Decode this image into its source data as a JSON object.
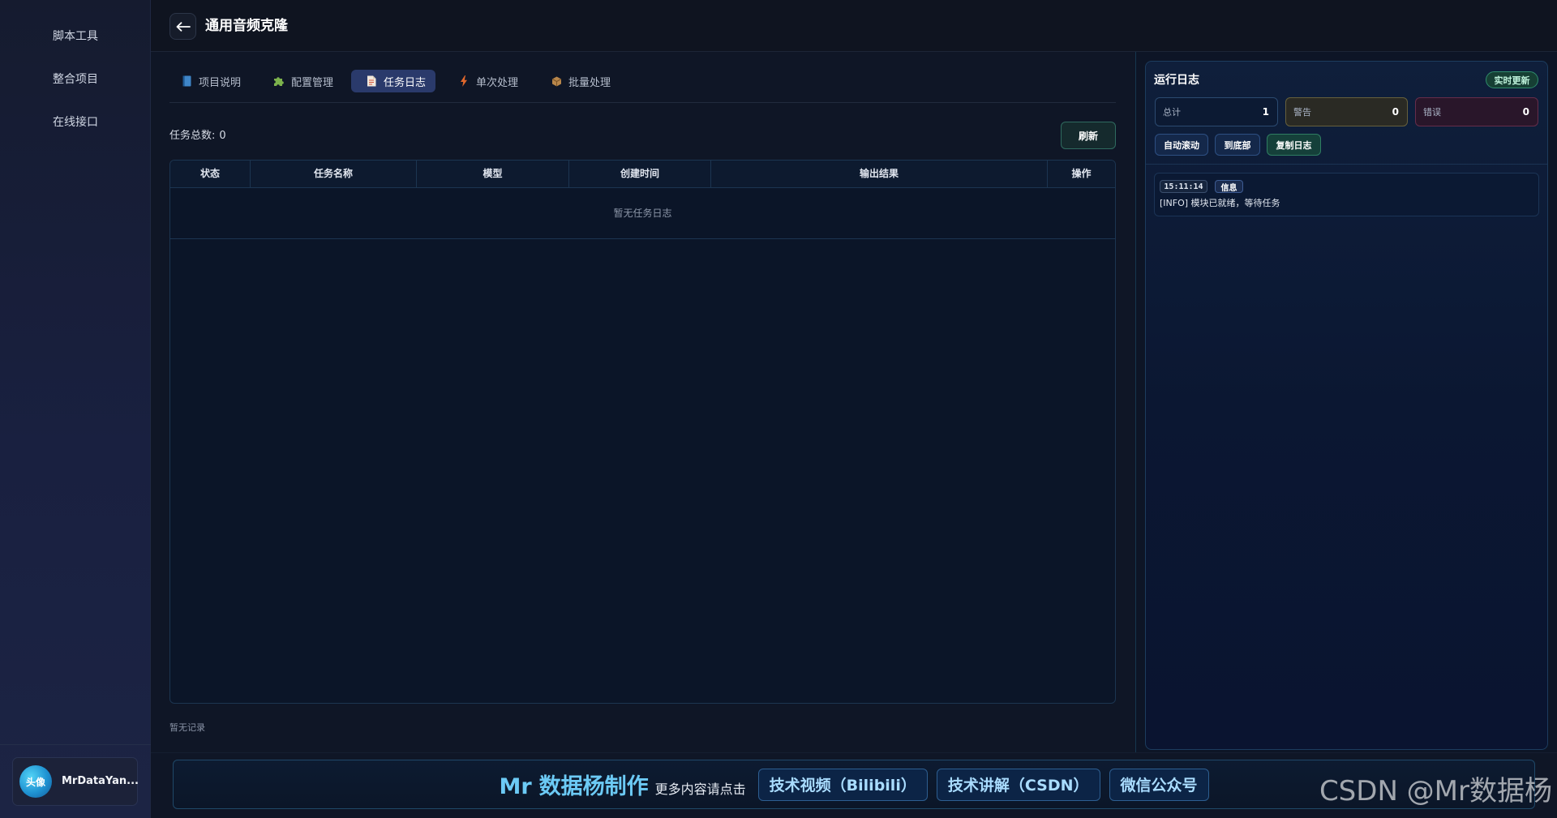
{
  "colors": {
    "brand": "#6ccaf5",
    "active_tab": "#2a3a6b",
    "live": "#2f8c6c",
    "warning": "#66603c",
    "error": "#662d4a"
  },
  "sidebar": {
    "items": [
      {
        "label": "脚本工具"
      },
      {
        "label": "整合项目"
      },
      {
        "label": "在线接口"
      }
    ],
    "user": {
      "avatar_text": "头像",
      "name": "MrDataYan..."
    }
  },
  "header": {
    "back_icon": "arrow-left-icon",
    "title": "通用音频克隆"
  },
  "tabs": [
    {
      "label": "项目说明",
      "icon": "book-icon",
      "active": false
    },
    {
      "label": "配置管理",
      "icon": "puzzle-icon",
      "active": false
    },
    {
      "label": "任务日志",
      "icon": "memo-icon",
      "active": true
    },
    {
      "label": "单次处理",
      "icon": "lightning-icon",
      "active": false
    },
    {
      "label": "批量处理",
      "icon": "package-icon",
      "active": false
    }
  ],
  "task_log": {
    "total_label": "任务总数:",
    "total_count": 0,
    "refresh_label": "刷新",
    "columns": [
      "状态",
      "任务名称",
      "模型",
      "创建时间",
      "输出结果",
      "操作"
    ],
    "empty_text": "暂无任务日志",
    "footer_text": "暂无记录"
  },
  "run_log": {
    "title": "运行日志",
    "live_badge": "实时更新",
    "stats": [
      {
        "label": "总计",
        "value": 1
      },
      {
        "label": "警告",
        "value": 0
      },
      {
        "label": "错误",
        "value": 0
      }
    ],
    "actions": [
      "自动滚动",
      "到底部",
      "复制日志"
    ],
    "entries": [
      {
        "time": "15:11:14",
        "level": "信息",
        "message": "[INFO] 模块已就绪，等待任务"
      }
    ]
  },
  "banner": {
    "brand_prefix": "Mr",
    "brand_name": "数据杨制作",
    "more_text": "更多内容请点击",
    "links": [
      "技术视频（Bilibili）",
      "技术讲解（CSDN）",
      "微信公众号"
    ]
  },
  "watermark": "CSDN @Mr数据杨"
}
